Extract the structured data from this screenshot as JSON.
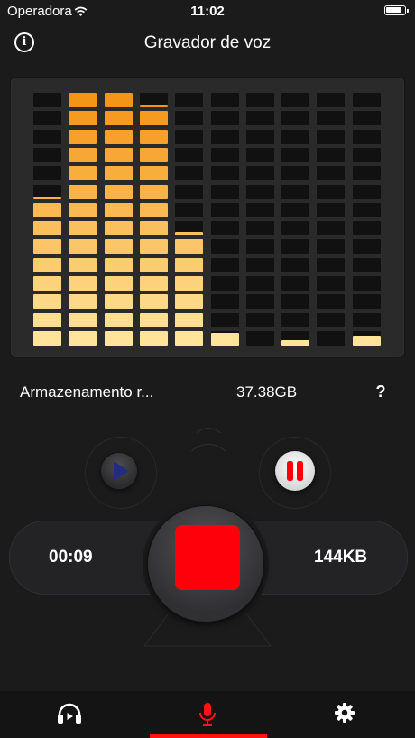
{
  "status_bar": {
    "carrier": "Operadora",
    "time": "11:02"
  },
  "header": {
    "title": "Gravador de voz"
  },
  "meter": {
    "bars": [
      0.59,
      1.0,
      1.0,
      0.95,
      0.45,
      0.05,
      0,
      0.02,
      0,
      0.04
    ],
    "colors": {
      "top": "#f59516",
      "bottom": "#ffe49a",
      "empty": "#111112"
    }
  },
  "storage": {
    "label": "Armazenamento r...",
    "value": "37.38GB",
    "help": "?"
  },
  "recording": {
    "elapsed": "00:09",
    "file_size": "144KB"
  },
  "colors": {
    "accent": "#fe000a",
    "play_icon": "#1f2a7a"
  },
  "tabs": [
    {
      "name": "playlist",
      "icon": "headphones-play-icon"
    },
    {
      "name": "record",
      "icon": "microphone-icon",
      "active": true
    },
    {
      "name": "settings",
      "icon": "gear-icon"
    }
  ]
}
